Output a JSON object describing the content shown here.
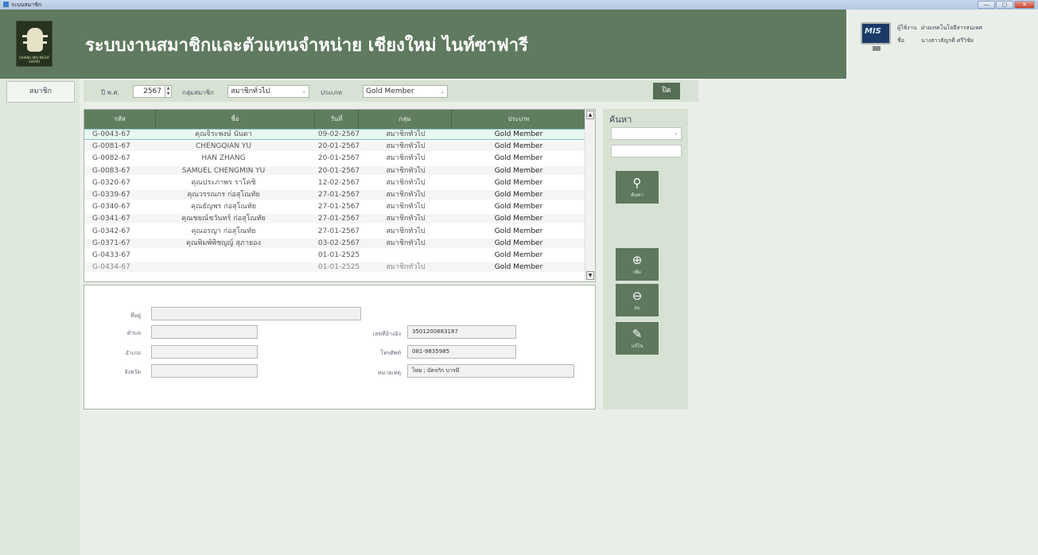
{
  "window": {
    "title": "ระบบสมาชิก",
    "buttons": [
      "—",
      "▢",
      "✕"
    ]
  },
  "header": {
    "app_title": "ระบบงานสมาชิกและตัวแทนจำหน่าย เชียงใหม่ ไนท์ซาฟารี",
    "logo_text": "CHIANG MAI NIGHT SAFARI"
  },
  "user": {
    "monitor_label": "MIS",
    "user_label": "ผู้ใช้งาน",
    "user_value": "ฝ่ายเทคโนโลยีสารสนเทศ",
    "name_label": "ชื่อ",
    "name_value": "นางสาวธัญรดี ศรีวิชัย"
  },
  "nav": {
    "members_label": "สมาชิก"
  },
  "filter": {
    "year_label": "ปี พ.ศ.",
    "year_value": "2567",
    "group_label": "กลุ่มสมาชิก",
    "group_value": "สมาชิกทั่วไป",
    "type_label": "ประเภท",
    "type_value": "Gold Member",
    "close_label": "ปิด"
  },
  "grid": {
    "columns": [
      "รหัส",
      "ชื่อ",
      "วันที่",
      "กลุ่ม",
      "ประเภท"
    ],
    "rows": [
      {
        "id": "G-0043-67",
        "name": "คุณจิระพงษ์ นันตา",
        "date": "09-02-2567",
        "group": "สมาชิกทั่วไป",
        "type": "Gold Member"
      },
      {
        "id": "G-0081-67",
        "name": "CHENGQIAN YU",
        "date": "20-01-2567",
        "group": "สมาชิกทั่วไป",
        "type": "Gold Member"
      },
      {
        "id": "G-0082-67",
        "name": "HAN ZHANG",
        "date": "20-01-2567",
        "group": "สมาชิกทั่วไป",
        "type": "Gold Member"
      },
      {
        "id": "G-0083-67",
        "name": "SAMUEL CHENGMIN YU",
        "date": "20-01-2567",
        "group": "สมาชิกทั่วไป",
        "type": "Gold Member"
      },
      {
        "id": "G-0320-67",
        "name": "คุณประภาพร ราโคชิ",
        "date": "12-02-2567",
        "group": "สมาชิกทั่วไป",
        "type": "Gold Member"
      },
      {
        "id": "G-0339-67",
        "name": "คุณวรรณกร ก่อสุโณทัย",
        "date": "27-01-2567",
        "group": "สมาชิกทั่วไป",
        "type": "Gold Member"
      },
      {
        "id": "G-0340-67",
        "name": "คุณธัญพร ก่อสุโณทัย",
        "date": "27-01-2567",
        "group": "สมาชิกทั่วไป",
        "type": "Gold Member"
      },
      {
        "id": "G-0341-67",
        "name": "คุณชยณ์ชวันทร์ ก่อสุโณทัย",
        "date": "27-01-2567",
        "group": "สมาชิกทั่วไป",
        "type": "Gold Member"
      },
      {
        "id": "G-0342-67",
        "name": "คุณอรญา ก่อสุโณทัย",
        "date": "27-01-2567",
        "group": "สมาชิกทั่วไป",
        "type": "Gold Member"
      },
      {
        "id": "G-0371-67",
        "name": "คุณพิมพ์พิชญญ์ สุภายอง",
        "date": "03-02-2567",
        "group": "สมาชิกทั่วไป",
        "type": "Gold Member"
      },
      {
        "id": "G-0433-67",
        "name": "",
        "date": "01-01-2525",
        "group": "",
        "type": "Gold Member"
      },
      {
        "id": "G-0434-67",
        "name": "",
        "date": "01-01-2525",
        "group": "สมาชิกทั่วไป",
        "type": "Gold Member"
      }
    ]
  },
  "detail": {
    "address_label": "ที่อยู่",
    "address_value": "",
    "subdistrict_label": "ตำบล",
    "subdistrict_value": "",
    "district_label": "อำเภอ",
    "district_value": "",
    "province_label": "จังหวัด",
    "province_value": "",
    "idcard_label": "เลขที่อ้างอิง",
    "idcard_value": "3501200883187",
    "phone_label": "โทรศัพท์",
    "phone_value": "081-9835985",
    "note_label": "หมายเหตุ",
    "note_value": "ไทย ; บัตรกัก บารมี"
  },
  "side": {
    "search_title": "ค้นหา",
    "search_field_value": "",
    "search_btn": "ค้นหา",
    "add_btn": "เพิ่ม",
    "delete_btn": "ลบ",
    "edit_btn": "แก้ไข"
  },
  "colors": {
    "header": "#5f7a5f",
    "button": "#5e785e",
    "background": "#e9efe8"
  }
}
